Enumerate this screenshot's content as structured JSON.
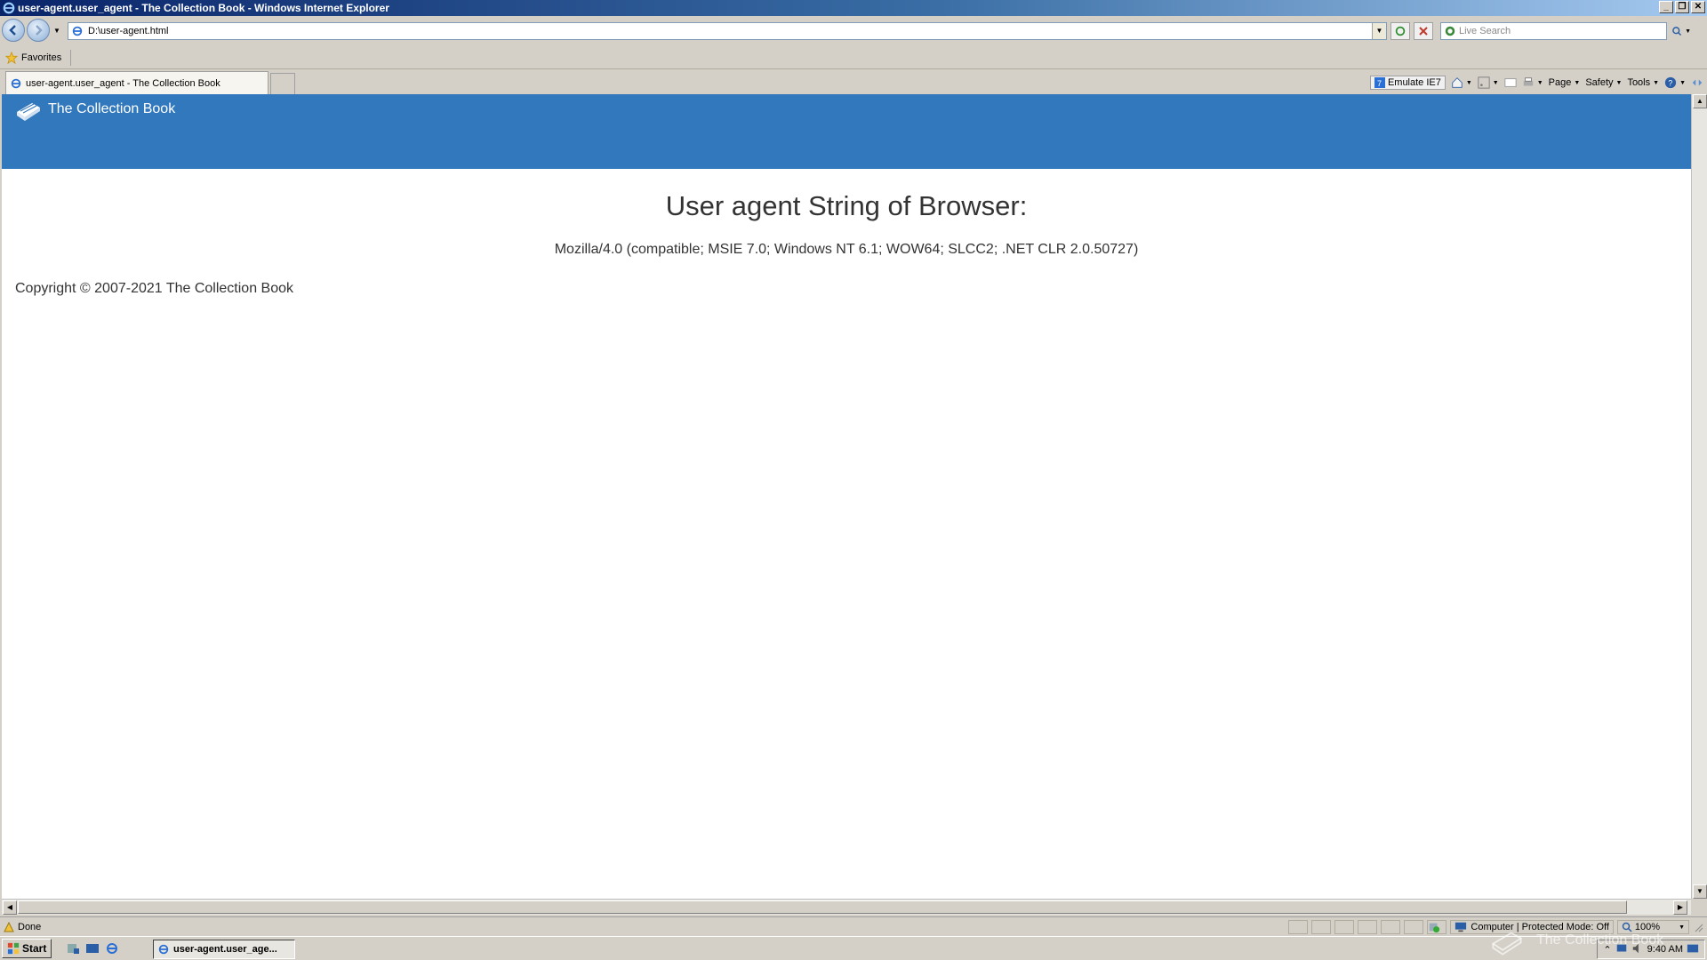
{
  "window": {
    "title": "user-agent.user_agent - The Collection Book - Windows Internet Explorer"
  },
  "addressbar": {
    "url": "D:\\user-agent.html",
    "search_placeholder": "Live Search"
  },
  "favorites": {
    "label": "Favorites"
  },
  "tab": {
    "title": "user-agent.user_agent - The Collection Book"
  },
  "commandbar": {
    "emulate": "Emulate IE7",
    "page": "Page",
    "safety": "Safety",
    "tools": "Tools"
  },
  "page": {
    "brand": "The Collection Book",
    "heading": "User agent String of Browser:",
    "user_agent": "Mozilla/4.0 (compatible; MSIE 7.0; Windows NT 6.1; WOW64; SLCC2; .NET CLR 2.0.50727)",
    "copyright": "Copyright © 2007-2021 The Collection Book",
    "banner_color": "#3278bd"
  },
  "statusbar": {
    "status": "Done",
    "zone": "Computer | Protected Mode: Off",
    "zoom": "100%"
  },
  "taskbar": {
    "start": "Start",
    "task": "user-agent.user_age...",
    "clock": "9:40 AM"
  },
  "watermark": {
    "text": "The Collection Book"
  }
}
